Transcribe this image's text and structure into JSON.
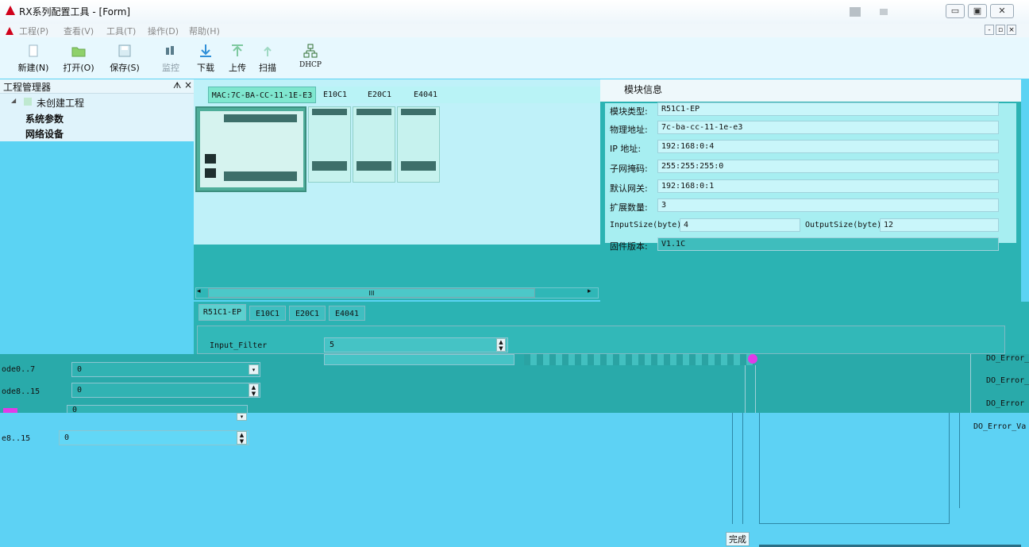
{
  "window": {
    "title": "RX系列配置工具 - [Form]",
    "controls": [
      "▭",
      "▣",
      "✕"
    ]
  },
  "menu": [
    {
      "label": "工程(P)"
    },
    {
      "label": "查看(V)"
    },
    {
      "label": "工具(T)"
    },
    {
      "label": "操作(D)"
    },
    {
      "label": "帮助(H)"
    }
  ],
  "toolbar": [
    {
      "label": "新建(N)",
      "icon": "new-file-icon"
    },
    {
      "label": "打开(O)",
      "icon": "folder-open-icon"
    },
    {
      "label": "保存(S)",
      "icon": "save-icon"
    },
    {
      "label": "监控",
      "icon": "monitor-icon"
    },
    {
      "label": "下载",
      "icon": "download-icon"
    },
    {
      "label": "上传",
      "icon": "upload-icon"
    },
    {
      "label": "扫描",
      "icon": "scan-icon"
    },
    {
      "label": "DHCP",
      "icon": "network-icon"
    }
  ],
  "project_manager": {
    "title": "工程管理器",
    "pin": "ᗑ",
    "close": "×",
    "root": "未创建工程",
    "children": [
      "系统参数",
      "网络设备"
    ]
  },
  "module_tabs": [
    "MAC:7C-BA-CC-11-1E-E3",
    "E10C1",
    "E20C1",
    "E4041"
  ],
  "scrollbar": {
    "thumb": "III",
    "left": "◂",
    "right": "▸"
  },
  "module_info": {
    "title": "模块信息",
    "fields": [
      {
        "label": "模块类型:",
        "value": "R51C1-EP"
      },
      {
        "label": "物理地址:",
        "value": "7c-ba-cc-11-1e-e3"
      },
      {
        "label": "IP 地址:",
        "value": "192:168:0:4"
      },
      {
        "label": "子网掩码:",
        "value": "255:255:255:0"
      },
      {
        "label": "默认网关:",
        "value": "192:168:0:1"
      },
      {
        "label": "扩展数量:",
        "value": "3"
      }
    ],
    "input_size_label": "InputSize(byte)",
    "input_size_value": "4",
    "output_size_label": "OutputSize(byte)",
    "output_size_value": "12",
    "firmware_label": "固件版本:",
    "firmware_value": "V1.1C"
  },
  "bottom_tabs": [
    "R51C1-EP",
    "E10C1",
    "E20C1",
    "E4041"
  ],
  "params": {
    "input_filter_label": "Input_Filter",
    "input_filter_value": "5",
    "rows": [
      {
        "label": "ode0..7",
        "value": "0"
      },
      {
        "label": "ode8..15",
        "value": "0"
      },
      {
        "label": "",
        "value": "0"
      },
      {
        "label": "e8..15",
        "value": "0"
      }
    ]
  },
  "do_errors": [
    "DO_Error_",
    "DO_Error_",
    "DO_Error",
    "DO_Error_Va"
  ],
  "finish_button": "完成",
  "colors": {
    "accent": "#5bd3f3",
    "panel": "#2bb3b3",
    "logo": "#d0021b"
  }
}
